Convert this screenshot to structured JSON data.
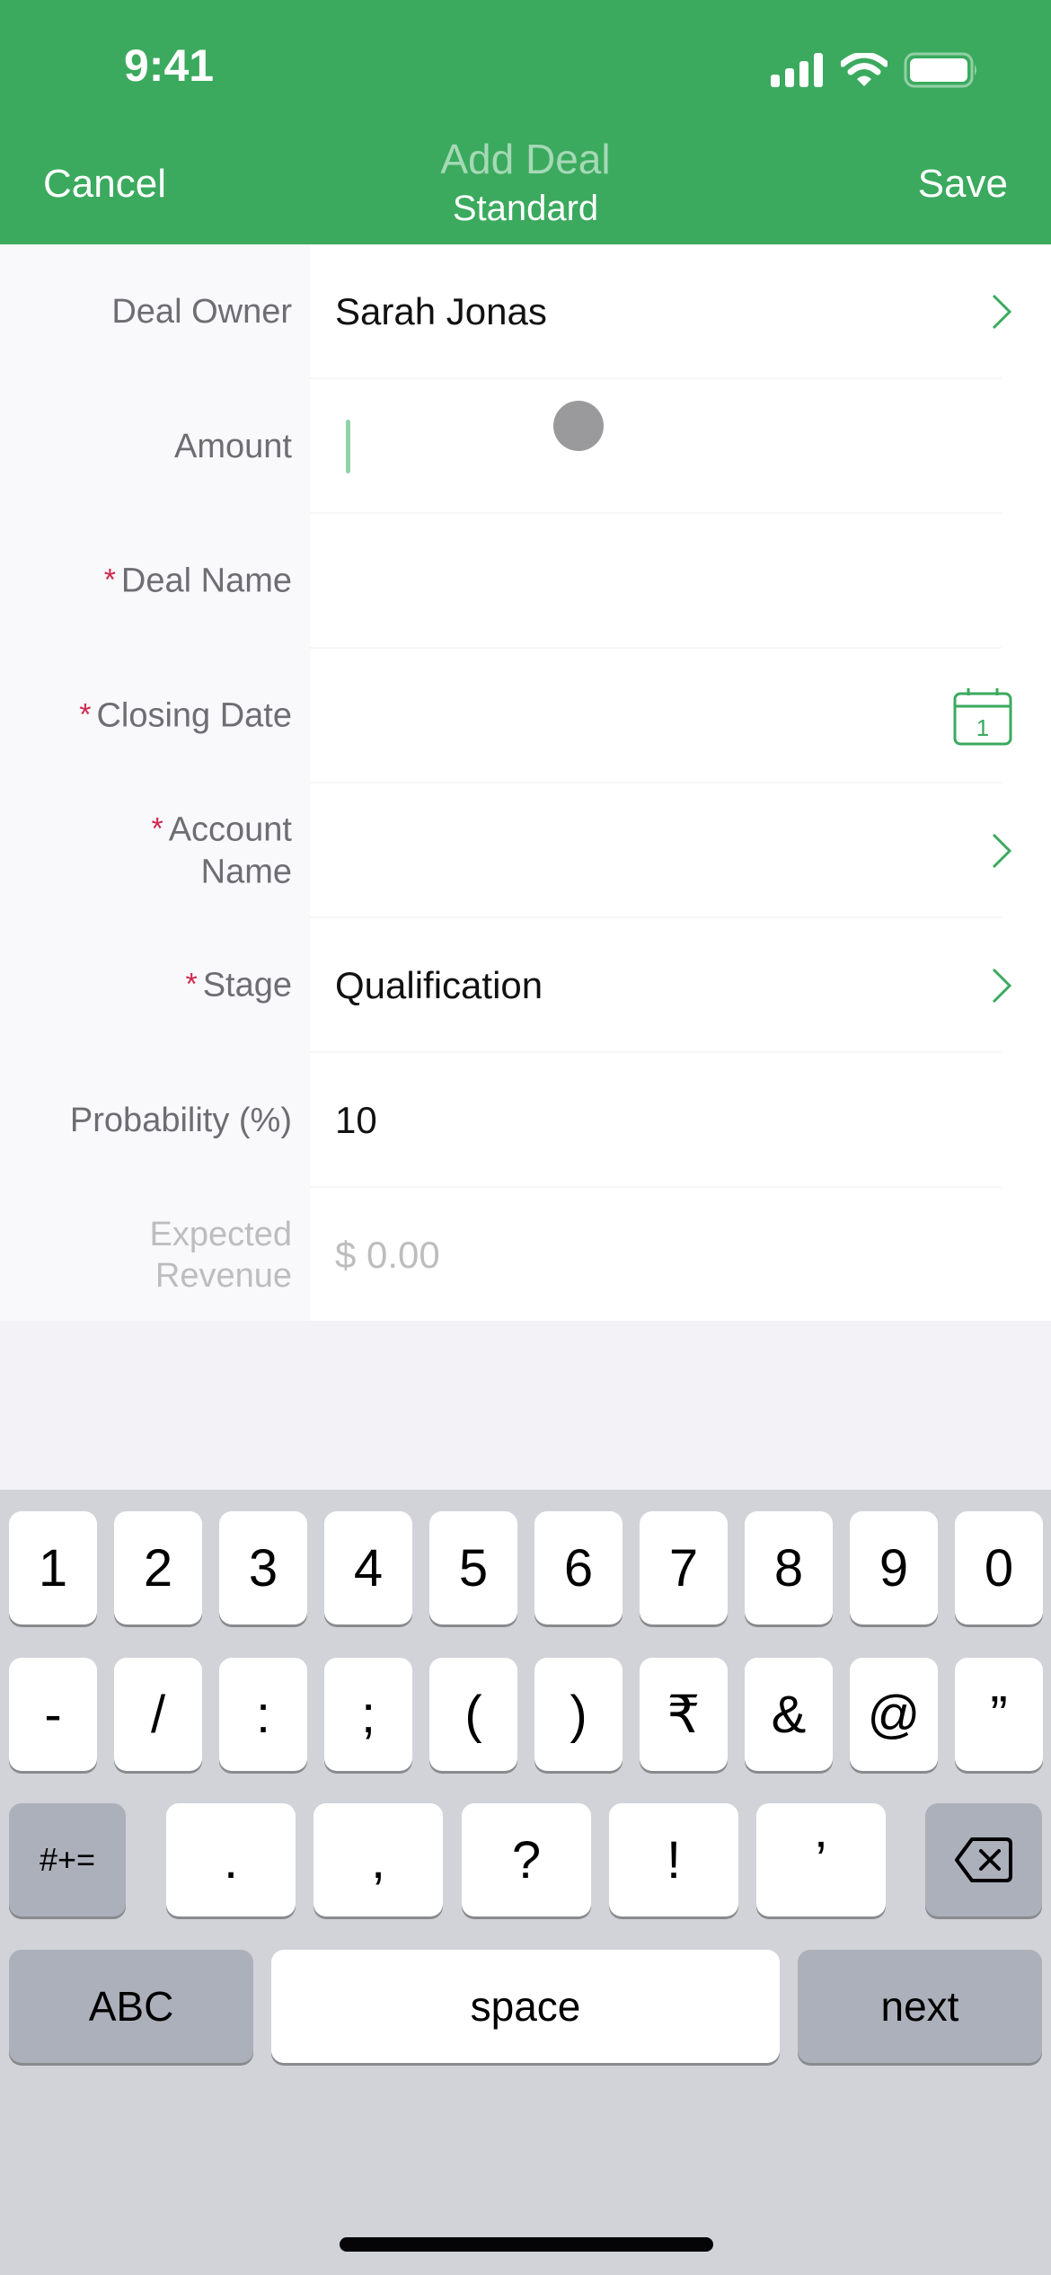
{
  "status_bar": {
    "time": "9:41",
    "icons": [
      "cellular-signal-icon",
      "wifi-icon",
      "battery-icon"
    ]
  },
  "nav": {
    "cancel_label": "Cancel",
    "title": "Add Deal",
    "subtitle": "Standard",
    "save_label": "Save"
  },
  "colors": {
    "brand_green": "#3BAA5E",
    "required_marker": "#D0284E",
    "label_gray": "#6E6E72",
    "keyboard_bg": "#D1D3D9"
  },
  "form": {
    "fields": [
      {
        "label": "Deal Owner",
        "required": false,
        "value": "Sarah Jonas",
        "accessory": "chevron-right-icon"
      },
      {
        "label": "Amount",
        "required": false,
        "value": "",
        "focused": true
      },
      {
        "label": "Deal Name",
        "required": true,
        "value": ""
      },
      {
        "label": "Closing Date",
        "required": true,
        "value": "",
        "accessory": "calendar-icon",
        "calendar_day": "1"
      },
      {
        "label_line1": "Account",
        "label_line2": "Name",
        "required": true,
        "value": "",
        "accessory": "chevron-right-icon"
      },
      {
        "label": "Stage",
        "required": true,
        "value": "Qualification",
        "accessory": "chevron-right-icon"
      },
      {
        "label": "Probability (%)",
        "required": false,
        "value": "10"
      },
      {
        "label_line1": "Expected",
        "label_line2": "Revenue",
        "required": false,
        "value": "$ 0.00",
        "read_only": true
      }
    ],
    "required_marker": "*"
  },
  "keyboard": {
    "row1": [
      "1",
      "2",
      "3",
      "4",
      "5",
      "6",
      "7",
      "8",
      "9",
      "0"
    ],
    "row2": [
      "-",
      "/",
      ":",
      ";",
      "(",
      ")",
      "₹",
      "&",
      "@",
      "”"
    ],
    "row3": {
      "shift_label": "#+=",
      "keys": [
        ".",
        ",",
        "?",
        "!",
        "’"
      ],
      "delete_icon": "backspace-icon"
    },
    "row4": {
      "abc_label": "ABC",
      "space_label": "space",
      "next_label": "next"
    }
  }
}
